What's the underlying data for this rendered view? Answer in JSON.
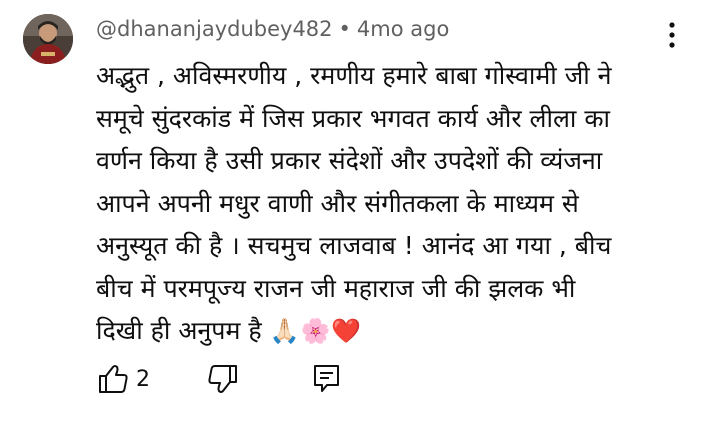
{
  "comment": {
    "author": "@dhananjaydubey482",
    "separator": "•",
    "time": "4mo ago",
    "lines": [
      "अद्भुत , अविस्मरणीय , रमणीय  हमारे बाबा गोस्वामी जी ने",
      "समूचे सुंदरकांड में जिस प्रकार भगवत कार्य और लीला का",
      "वर्णन किया है उसी प्रकार संदेशों और उपदेशों की व्यंजना",
      "आपने अपनी मधुर वाणी और संगीतकला के माध्यम से",
      "अनुस्यूत की है । सचमुच लाजवाब ! आनंद आ गया , बीच",
      "बीच में परमपूज्य राजन जी महाराज जी की झलक भी",
      "दिखी ही अनुपम है "
    ],
    "emojis": "🙏🏻🌸❤️",
    "like_count": "2"
  },
  "icons": {
    "avatar": "avatar",
    "menu": "more-vert-icon",
    "like": "thumb-up-icon",
    "dislike": "thumb-down-icon",
    "reply": "reply-comment-icon"
  }
}
